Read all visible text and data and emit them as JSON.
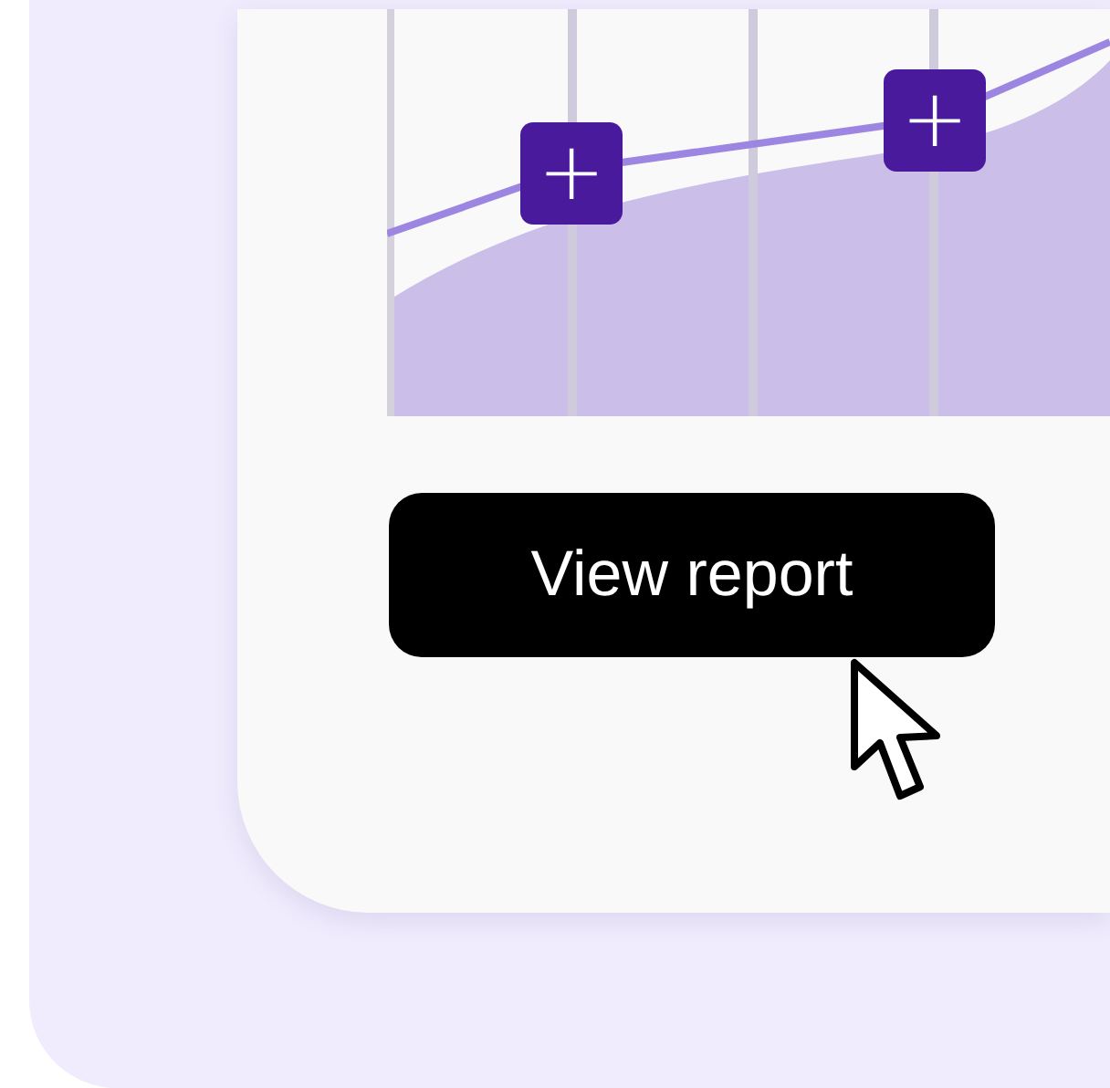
{
  "chart": {
    "add_buttons": [
      {
        "label": "+"
      },
      {
        "label": "+"
      }
    ]
  },
  "button": {
    "label": "View report"
  }
}
